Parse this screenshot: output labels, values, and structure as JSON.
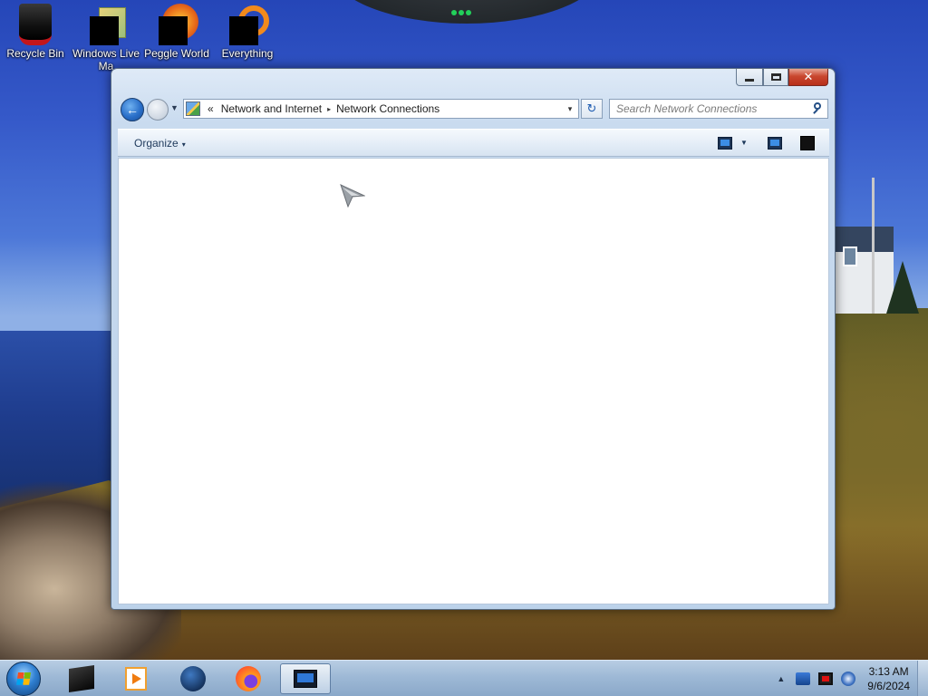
{
  "desktop": {
    "icons": [
      {
        "label": "Recycle Bin",
        "icon": "recycle-bin-icon"
      },
      {
        "label": "Windows Live Ma",
        "icon": "windows-live-mail-icon"
      },
      {
        "label": "Peggle World",
        "icon": "peggle-world-icon"
      },
      {
        "label": "Everything",
        "icon": "everything-search-icon"
      }
    ]
  },
  "window": {
    "caption_buttons": [
      "minimize",
      "maximize",
      "close"
    ],
    "back_icon": "back-arrow-icon",
    "address": {
      "overflow_glyph": "«",
      "segments": [
        "Network and Internet",
        "Network Connections"
      ],
      "separator_glyph": "▸",
      "dropdown_glyph": "▾"
    },
    "refresh_glyph": "↻",
    "search": {
      "placeholder": "Search Network Connections"
    },
    "command_bar": {
      "organize_label": "Organize",
      "caret": "▾"
    },
    "content_items": []
  },
  "taskbar": {
    "items": [
      {
        "name": "start-button",
        "icon": "windows-orb-icon"
      },
      {
        "name": "taskbar-app-1",
        "icon": "black-app-icon"
      },
      {
        "name": "taskbar-app-2",
        "icon": "media-player-icon"
      },
      {
        "name": "taskbar-app-3",
        "icon": "globe-icon"
      },
      {
        "name": "taskbar-app-4",
        "icon": "firefox-icon"
      },
      {
        "name": "taskbar-app-5",
        "icon": "network-connections-icon",
        "active": true
      }
    ],
    "tray_arrow": "▲",
    "clock": {
      "time": "3:13 AM",
      "date": "9/6/2024"
    }
  },
  "colors": {
    "taskbar": "#9eb9d6",
    "close_button": "#c9472f",
    "window_frame": "#c9dbef"
  }
}
